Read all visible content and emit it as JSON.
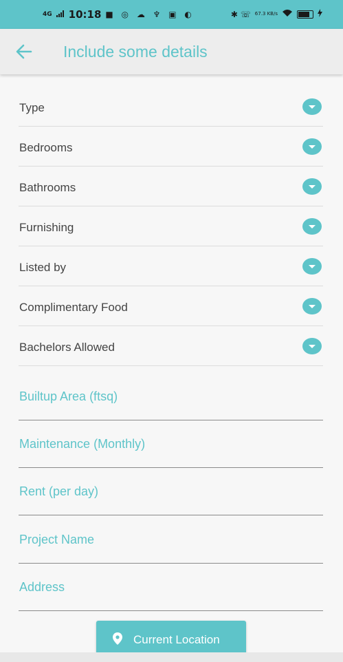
{
  "status_bar": {
    "network": "4G",
    "time": "10:18",
    "notif_icons": "■ ◎ ☁ ♆ ▣ ◐",
    "right_icons": "✱ ☏",
    "speed": "67.3 KB/s",
    "battery_level": 0.72
  },
  "app_bar": {
    "title": "Include some details"
  },
  "dropdowns": [
    {
      "label": "Type"
    },
    {
      "label": "Bedrooms"
    },
    {
      "label": "Bathrooms"
    },
    {
      "label": "Furnishing"
    },
    {
      "label": "Listed by"
    },
    {
      "label": "Complimentary Food"
    },
    {
      "label": "Bachelors Allowed"
    }
  ],
  "fields": [
    {
      "placeholder": "Builtup Area (ftsq)"
    },
    {
      "placeholder": "Maintenance (Monthly)"
    },
    {
      "placeholder": "Rent (per day)"
    },
    {
      "placeholder": "Project Name"
    },
    {
      "placeholder": "Address"
    }
  ],
  "location_button": {
    "label": "Current Location"
  },
  "colors": {
    "accent": "#5ec4c9",
    "background": "#f7f7f7",
    "app_bar": "#ededed"
  }
}
